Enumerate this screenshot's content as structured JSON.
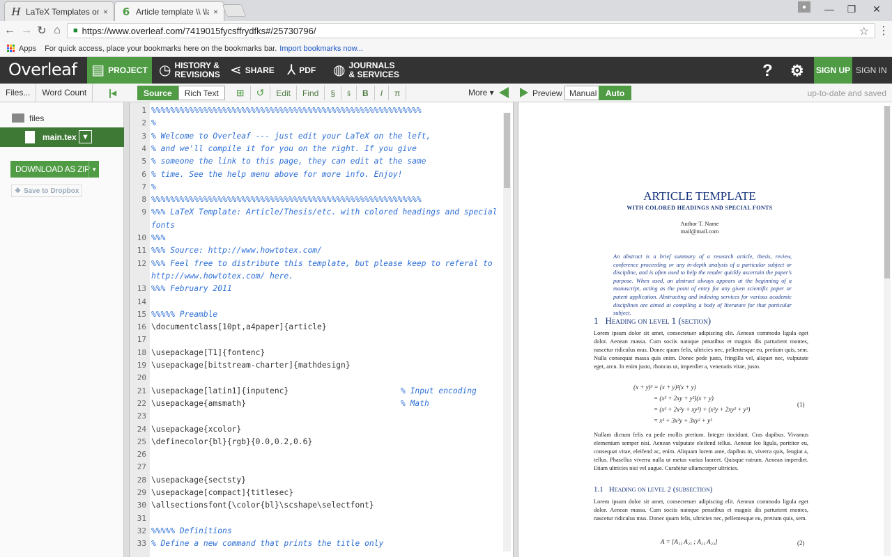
{
  "browser": {
    "tabs": [
      {
        "icon": "H",
        "title": "LaTeX Templates on How",
        "close": "×"
      },
      {
        "icon": "6",
        "title": "Article template \\\\ \\larg",
        "close": "×"
      }
    ],
    "url": "https://www.overleaf.com/7419015fycsffrydfks#/25730796/",
    "bookmarks_apps": "Apps",
    "bookmarks_hint": "For quick access, place your bookmarks here on the bookmarks bar.",
    "bookmarks_import": "Import bookmarks now...",
    "minimize": "—",
    "maximize": "❐",
    "close": "✕"
  },
  "overleaf": {
    "logo": "Overleaf",
    "nav": {
      "project": "PROJECT",
      "history_1": "HISTORY &",
      "history_2": "REVISIONS",
      "share": "SHARE",
      "pdf": "PDF",
      "journals_1": "JOURNALS",
      "journals_2": "& SERVICES",
      "help": "?",
      "signup": "SIGN UP",
      "signin": "SIGN IN"
    },
    "toolbar": {
      "files": "Files...",
      "word_count": "Word Count",
      "source": "Source",
      "rich_text": "Rich Text",
      "edit": "Edit",
      "find": "Find",
      "section": "§",
      "subsection": "§",
      "bold": "B",
      "italic": "I",
      "math": "π",
      "more": "More ▾",
      "preview": "Preview",
      "manual": "Manual",
      "auto": "Auto",
      "status": "up-to-date and saved"
    },
    "filetree": {
      "folder": "files",
      "file": "main.tex",
      "download": "DOWNLOAD AS ZIP",
      "dropbox": "Save to Dropbox"
    }
  },
  "editor": {
    "lines": [
      {
        "n": "1",
        "c": "%%%%%%%%%%%%%%%%%%%%%%%%%%%%%%%%%%%%%%%%%%%%%%%%%%%%%%%%%",
        "t": "cmt"
      },
      {
        "n": "2",
        "c": "%",
        "t": "cmt"
      },
      {
        "n": "3",
        "c": "% Welcome to Overleaf --- just edit your LaTeX on the left,",
        "t": "cmt"
      },
      {
        "n": "4",
        "c": "% and we'll compile it for you on the right. If you give",
        "t": "cmt"
      },
      {
        "n": "5",
        "c": "% someone the link to this page, they can edit at the same",
        "t": "cmt"
      },
      {
        "n": "6",
        "c": "% time. See the help menu above for more info. Enjoy!",
        "t": "cmt"
      },
      {
        "n": "7",
        "c": "%",
        "t": "cmt"
      },
      {
        "n": "8",
        "c": "%%%%%%%%%%%%%%%%%%%%%%%%%%%%%%%%%%%%%%%%%%%%%%%%%%%%%%%%%",
        "t": "cmt"
      },
      {
        "n": "9",
        "c": "%%% LaTeX Template: Article/Thesis/etc. with colored headings and special",
        "t": "cmt"
      },
      {
        "n": "",
        "c": "fonts",
        "t": "cmt"
      },
      {
        "n": "10",
        "c": "%%%",
        "t": "cmt"
      },
      {
        "n": "11",
        "c": "%%% Source: http://www.howtotex.com/",
        "t": "cmt"
      },
      {
        "n": "12",
        "c": "%%% Feel free to distribute this template, but please keep to referal to",
        "t": "cmt"
      },
      {
        "n": "",
        "c": "http://www.howtotex.com/ here.",
        "t": "cmt"
      },
      {
        "n": "13",
        "c": "%%% February 2011",
        "t": "cmt"
      },
      {
        "n": "14",
        "c": "",
        "t": "code"
      },
      {
        "n": "15",
        "c": "%%%%% Preamble",
        "t": "cmt"
      },
      {
        "n": "16",
        "c": "\\documentclass[10pt,a4paper]{article}",
        "t": "code"
      },
      {
        "n": "17",
        "c": "",
        "t": "code"
      },
      {
        "n": "18",
        "c": "\\usepackage[T1]{fontenc}",
        "t": "code"
      },
      {
        "n": "19",
        "c": "\\usepackage[bitstream-charter]{mathdesign}",
        "t": "code"
      },
      {
        "n": "20",
        "c": "",
        "t": "code"
      },
      {
        "n": "21",
        "c": "\\usepackage[latin1]{inputenc}",
        "t": "code",
        "cm": "% Input encoding"
      },
      {
        "n": "22",
        "c": "\\usepackage{amsmath}",
        "t": "code",
        "cm": "% Math"
      },
      {
        "n": "23",
        "c": "",
        "t": "code"
      },
      {
        "n": "24",
        "c": "\\usepackage{xcolor}",
        "t": "code"
      },
      {
        "n": "25",
        "c": "\\definecolor{bl}{rgb}{0.0,0.2,0.6}",
        "t": "code"
      },
      {
        "n": "26",
        "c": "",
        "t": "code"
      },
      {
        "n": "27",
        "c": "",
        "t": "code"
      },
      {
        "n": "28",
        "c": "\\usepackage{sectsty}",
        "t": "code"
      },
      {
        "n": "29",
        "c": "\\usepackage[compact]{titlesec}",
        "t": "code"
      },
      {
        "n": "30",
        "c": "\\allsectionsfont{\\color{bl}\\scshape\\selectfont}",
        "t": "code"
      },
      {
        "n": "31",
        "c": "",
        "t": "code"
      },
      {
        "n": "32",
        "c": "%%%%% Definitions",
        "t": "cmt"
      },
      {
        "n": "33",
        "c": "% Define a new command that prints the title only",
        "t": "cmt"
      }
    ]
  },
  "pdf": {
    "title": "ARTICLE TEMPLATE",
    "subtitle": "WITH COLORED HEADINGS AND SPECIAL FONTS",
    "author": "Author T. Name",
    "email": "mail@mail.com",
    "abstract": "An abstract is a brief summary of a research article, thesis, review, conference proceeding or any in-depth analysis of a particular subject or discipline, and is often used to help the reader quickly ascertain the paper's purpose. When used, an abstract always appears at the beginning of a manuscript, acting as the point of entry for any given scientific paper or patent application. Abstracting and indexing services for various academic disciplines are aimed at compiling a body of literature for that particular subject.",
    "h1_num": "1",
    "h1": "Heading on level 1 (section)",
    "p1": "Lorem ipsum dolor sit amet, consectetuer adipiscing elit. Aenean commodo ligula eget dolor. Aenean massa. Cum sociis natoque penatibus et magnis dis parturient montes, nascetur ridiculus mus. Donec quam felis, ultricies nec, pellentesque eu, pretium quis, sem. Nulla consequat massa quis enim. Donec pede justo, fringilla vel, aliquet nec, vulputate eget, arcu. In enim justo, rhoncus ut, imperdiet a, venenatis vitae, justo.",
    "eq1_l1": "(x + y)³ = (x + y)²(x + y)",
    "eq1_l2": "= (x² + 2xy + y²)(x + y)",
    "eq1_l3": "= (x³ + 2x²y + xy²) + (x²y + 2xy² + y³)",
    "eq1_l4": "= x³ + 3x²y + 3xy² + y³",
    "eq1_num": "(1)",
    "p2": "Nullam dictum felis eu pede mollis pretium. Integer tincidunt. Cras dapibus. Vivamus elementum semper nisi. Aenean vulputate eleifend tellus. Aenean leo ligula, porttitor eu, consequat vitae, eleifend ac, enim. Aliquam lorem ante, dapibus in, viverra quis, feugiat a, tellus. Phasellus viverra nulla ut metus varius laoreet. Quisque rutrum. Aenean imperdiet. Etiam ultricies nisi vel augue. Curabitur ullamcorper ultricies.",
    "h2_num": "1.1",
    "h2": "Heading on level 2 (subsection)",
    "p3": "Lorem ipsum dolor sit amet, consectetuer adipiscing elit. Aenean commodo ligula eget dolor. Aenean massa. Cum sociis natoque penatibus et magnis dis parturient montes, nascetur ridiculus mus. Donec quam felis, ultricies nec, pellentesque eu, pretium quis, sem.",
    "eq2": "A = [A₁₁ A₂₁ ; A₂₁ A₂₂]",
    "eq2_num": "(2)"
  },
  "colors": {
    "accent": "#4f9c45",
    "header": "#333333",
    "comment": "#2e6fd6",
    "pdf_heading": "#14327a"
  }
}
